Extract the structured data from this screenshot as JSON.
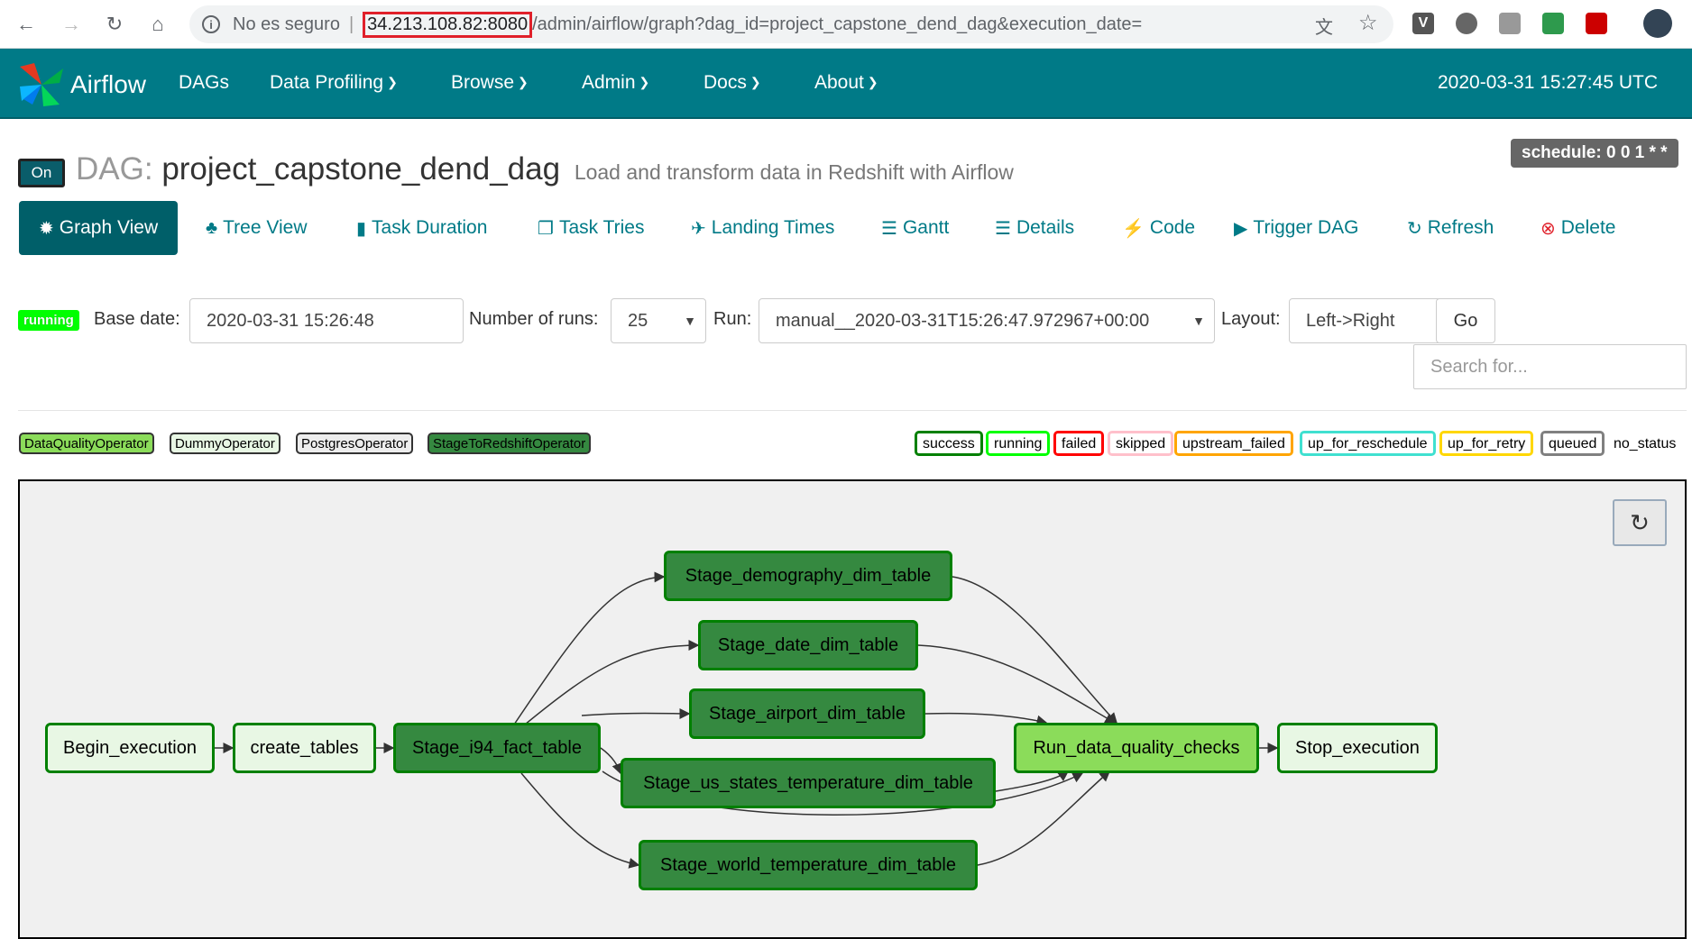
{
  "browser": {
    "security_label": "No es seguro",
    "url_host": "34.213.108.82:8080",
    "url_path": "/admin/airflow/graph?dag_id=project_capstone_dend_dag&execution_date="
  },
  "navbar": {
    "brand": "Airflow",
    "items": [
      {
        "label": "DAGs",
        "dropdown": false
      },
      {
        "label": "Data Profiling",
        "dropdown": true
      },
      {
        "label": "Browse",
        "dropdown": true
      },
      {
        "label": "Admin",
        "dropdown": true
      },
      {
        "label": "Docs",
        "dropdown": true
      },
      {
        "label": "About",
        "dropdown": true
      }
    ],
    "clock": "2020-03-31 15:27:45 UTC"
  },
  "dag": {
    "toggle": "On",
    "label": "DAG:",
    "id": "project_capstone_dend_dag",
    "description": "Load and transform data in Redshift with Airflow",
    "schedule": "schedule: 0 0 1 * *"
  },
  "tabs": [
    {
      "label": "Graph View",
      "icon": "asterisk-icon",
      "active": true
    },
    {
      "label": "Tree View",
      "icon": "tree-icon"
    },
    {
      "label": "Task Duration",
      "icon": "bar-chart-icon"
    },
    {
      "label": "Task Tries",
      "icon": "duplicate-icon"
    },
    {
      "label": "Landing Times",
      "icon": "plane-icon"
    },
    {
      "label": "Gantt",
      "icon": "align-left-icon"
    },
    {
      "label": "Details",
      "icon": "list-icon"
    },
    {
      "label": "Code",
      "icon": "flash-icon"
    },
    {
      "label": "Trigger DAG",
      "icon": "play-circle-icon"
    },
    {
      "label": "Refresh",
      "icon": "refresh-icon"
    },
    {
      "label": "Delete",
      "icon": "remove-circle-icon"
    }
  ],
  "controls": {
    "state": "running",
    "base_date_label": "Base date:",
    "base_date": "2020-03-31 15:26:48",
    "num_runs_label": "Number of runs:",
    "num_runs": "25",
    "run_label": "Run:",
    "run": "manual__2020-03-31T15:26:47.972967+00:00",
    "layout_label": "Layout:",
    "layout": "Left->Right",
    "go": "Go",
    "search_placeholder": "Search for..."
  },
  "operators": [
    {
      "label": "DataQualityOperator",
      "color": "#8bdc5a"
    },
    {
      "label": "DummyOperator",
      "color": "#e8f7e4"
    },
    {
      "label": "PostgresOperator",
      "color": "#ededed"
    },
    {
      "label": "StageToRedshiftOperator",
      "color": "#358940"
    }
  ],
  "states": [
    {
      "label": "success",
      "color": "#008000"
    },
    {
      "label": "running",
      "color": "#00ff00"
    },
    {
      "label": "failed",
      "color": "#ff0000"
    },
    {
      "label": "skipped",
      "color": "#ffc0cb"
    },
    {
      "label": "upstream_failed",
      "color": "#ffa500"
    },
    {
      "label": "up_for_reschedule",
      "color": "#40e0d0"
    },
    {
      "label": "up_for_retry",
      "color": "#ffd700"
    },
    {
      "label": "queued",
      "color": "#808080"
    },
    {
      "label": "no_status",
      "color": "#ffffff"
    }
  ],
  "graph": {
    "nodes": [
      {
        "id": "Begin_execution",
        "operator": "DummyOperator",
        "state": "success"
      },
      {
        "id": "create_tables",
        "operator": "PostgresOperator",
        "state": "success"
      },
      {
        "id": "Stage_i94_fact_table",
        "operator": "StageToRedshiftOperator",
        "state": "success"
      },
      {
        "id": "Stage_demography_dim_table",
        "operator": "StageToRedshiftOperator",
        "state": "success"
      },
      {
        "id": "Stage_date_dim_table",
        "operator": "StageToRedshiftOperator",
        "state": "success"
      },
      {
        "id": "Stage_airport_dim_table",
        "operator": "StageToRedshiftOperator",
        "state": "success"
      },
      {
        "id": "Stage_us_states_temperature_dim_table",
        "operator": "StageToRedshiftOperator",
        "state": "success"
      },
      {
        "id": "Stage_world_temperature_dim_table",
        "operator": "StageToRedshiftOperator",
        "state": "success"
      },
      {
        "id": "Run_data_quality_checks",
        "operator": "DataQualityOperator",
        "state": "success"
      },
      {
        "id": "Stop_execution",
        "operator": "DummyOperator",
        "state": "success"
      }
    ]
  }
}
